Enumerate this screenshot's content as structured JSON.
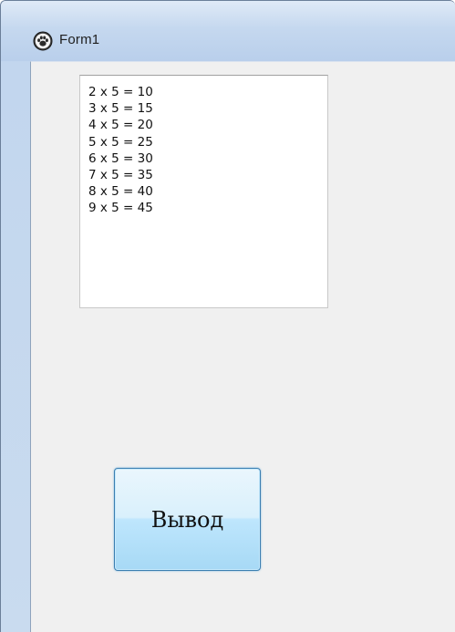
{
  "window": {
    "title": "Form1",
    "icon": "paw-icon"
  },
  "memo": {
    "lines": [
      "2 x 5 = 10",
      "3 x 5 = 15",
      "4 x 5 = 20",
      "5 x 5 = 25",
      "6 x 5 = 30",
      "7 x 5 = 35",
      "8 x 5 = 40",
      "9 x 5 = 45"
    ]
  },
  "button": {
    "label": "Вывод"
  },
  "colors": {
    "titlebar": "#c5d8ef",
    "client": "#f0f0f0",
    "button_accent": "#3c7fb1"
  }
}
